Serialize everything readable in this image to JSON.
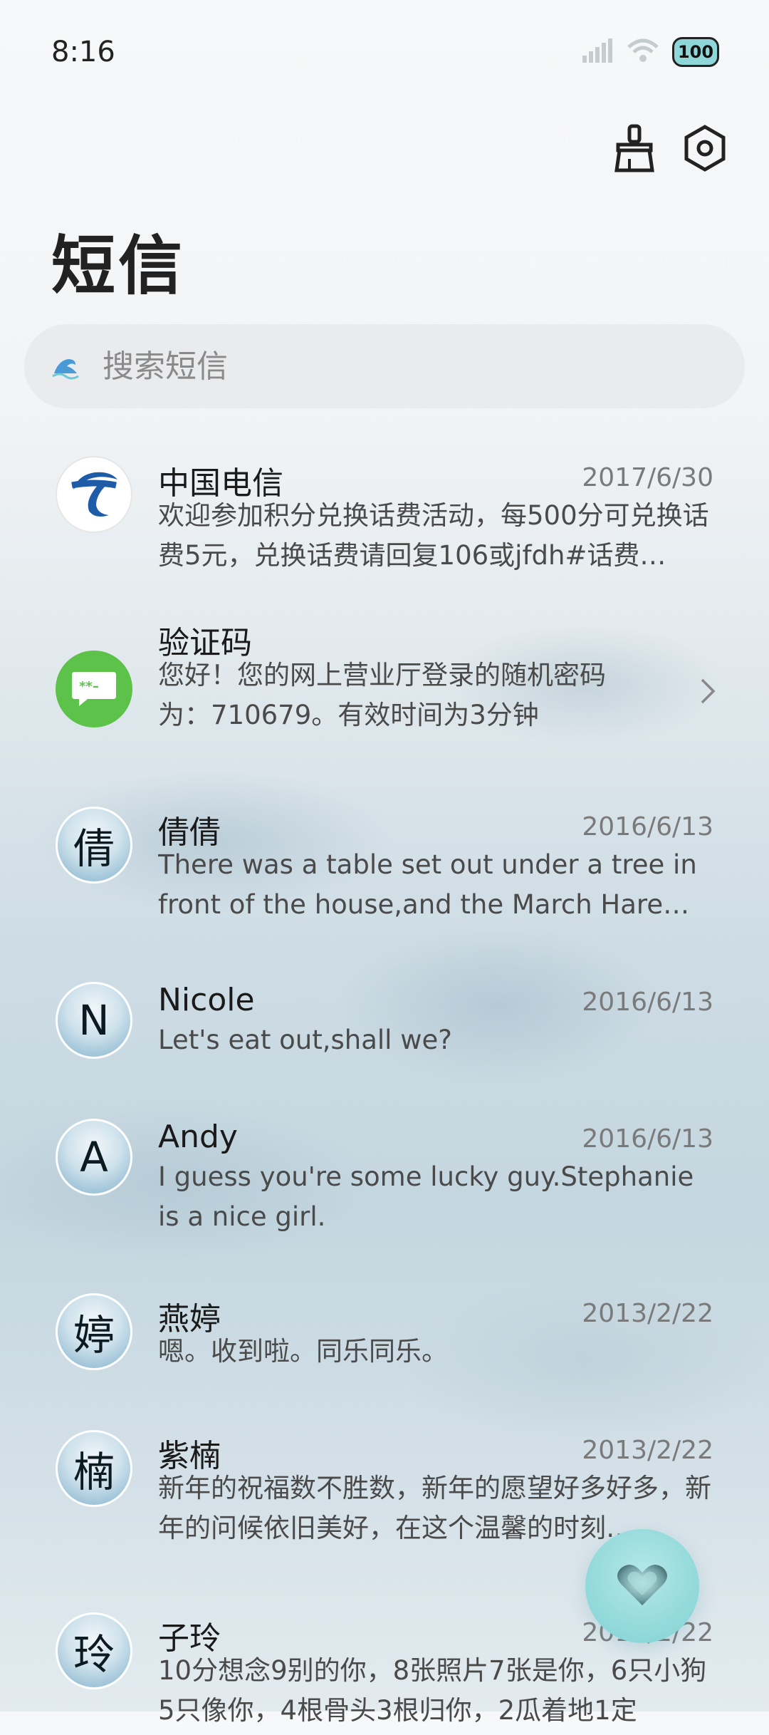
{
  "status_bar": {
    "time": "8:16",
    "battery": "100",
    "signal_icon": "signal-icon",
    "wifi_icon": "wifi-icon"
  },
  "header": {
    "title": "短信",
    "clean_icon": "brush-icon",
    "settings_icon": "settings-hex-icon"
  },
  "search": {
    "placeholder": "搜索短信"
  },
  "conversations": [
    {
      "name": "中国电信",
      "date": "2017/6/30",
      "preview": "欢迎参加积分兑换话费活动，每500分可兑换话费5元，兑换话费请回复106或jfdh#话费…",
      "avatar": "telecom-logo"
    },
    {
      "name": "验证码",
      "date": "",
      "preview": "您好！您的网上营业厅登录的随机密码为：710679。有效时间为3分钟",
      "avatar": "verification-code-icon"
    },
    {
      "name": "倩倩",
      "date": "2016/6/13",
      "preview": "There was a table set out under a tree in front of the house,and the March Hare an…",
      "avatar_text": "倩"
    },
    {
      "name": "Nicole",
      "date": "2016/6/13",
      "preview": "Let's eat out,shall we?",
      "avatar_text": "N"
    },
    {
      "name": "Andy",
      "date": "2016/6/13",
      "preview": "I guess you're some lucky guy.Stephanie is a nice girl.",
      "avatar_text": "A"
    },
    {
      "name": "燕婷",
      "date": "2013/2/22",
      "preview": "嗯。收到啦。同乐同乐。",
      "avatar_text": "婷"
    },
    {
      "name": "紫楠",
      "date": "2013/2/22",
      "preview": "新年的祝福数不胜数，新年的愿望好多好多，新年的问候依旧美好，在这个温馨的时刻…",
      "avatar_text": "楠"
    },
    {
      "name": "子玲",
      "date": "2013/2/22",
      "preview": "10分想念9别的你，8张照片7张是你，6只小狗5只像你，4根骨头3根归你，2瓜着地1定",
      "avatar_text": "玲"
    }
  ],
  "fab": {
    "icon": "heart-icon"
  }
}
